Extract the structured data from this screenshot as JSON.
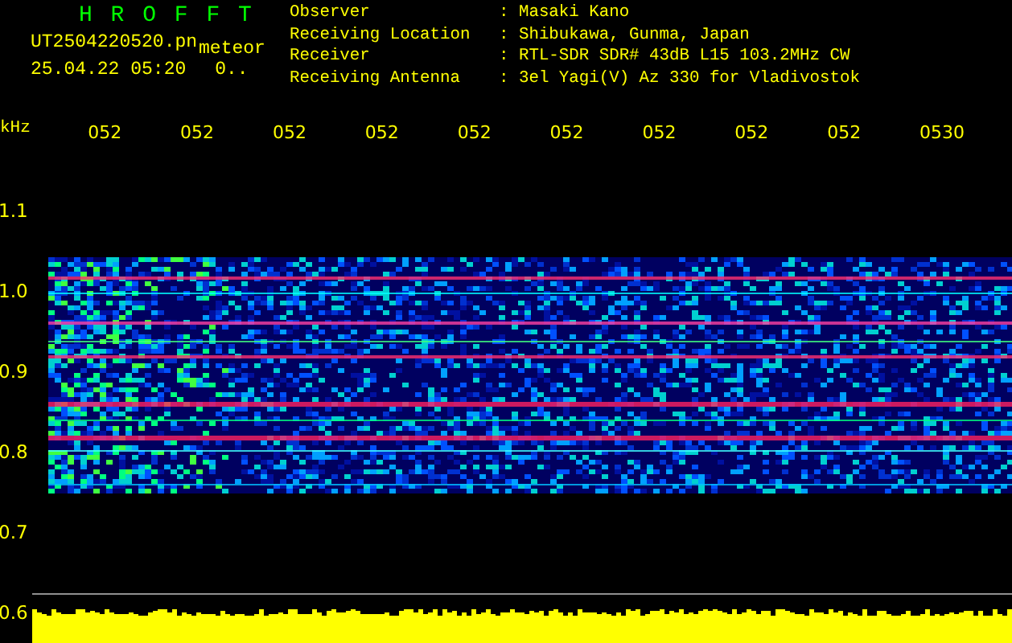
{
  "title": "H R O F F T",
  "file": {
    "name": "UT2504220520.pn",
    "type": "meteor",
    "date": "25.04.22 05:20",
    "status": "0.."
  },
  "station": [
    {
      "label": "Observer",
      "value": ": Masaki Kano"
    },
    {
      "label": "Receiving Location",
      "value": ": Shibukawa, Gunma, Japan"
    },
    {
      "label": "Receiver",
      "value": ": RTL-SDR SDR# 43dB L15 103.2MHz CW"
    },
    {
      "label": "Receiving Antenna",
      "value": ": 3el Yagi(V) Az 330 for Vladivostok"
    }
  ],
  "time_axis": {
    "ticks": [
      "052",
      "052",
      "052",
      "052",
      "052",
      "052",
      "052",
      "052",
      "052",
      "0530"
    ]
  },
  "freq_axis": {
    "unit": "kHz",
    "ticks": [
      "1.1",
      "1.0",
      "0.9",
      "0.8",
      "0.7",
      "0.6"
    ]
  }
}
